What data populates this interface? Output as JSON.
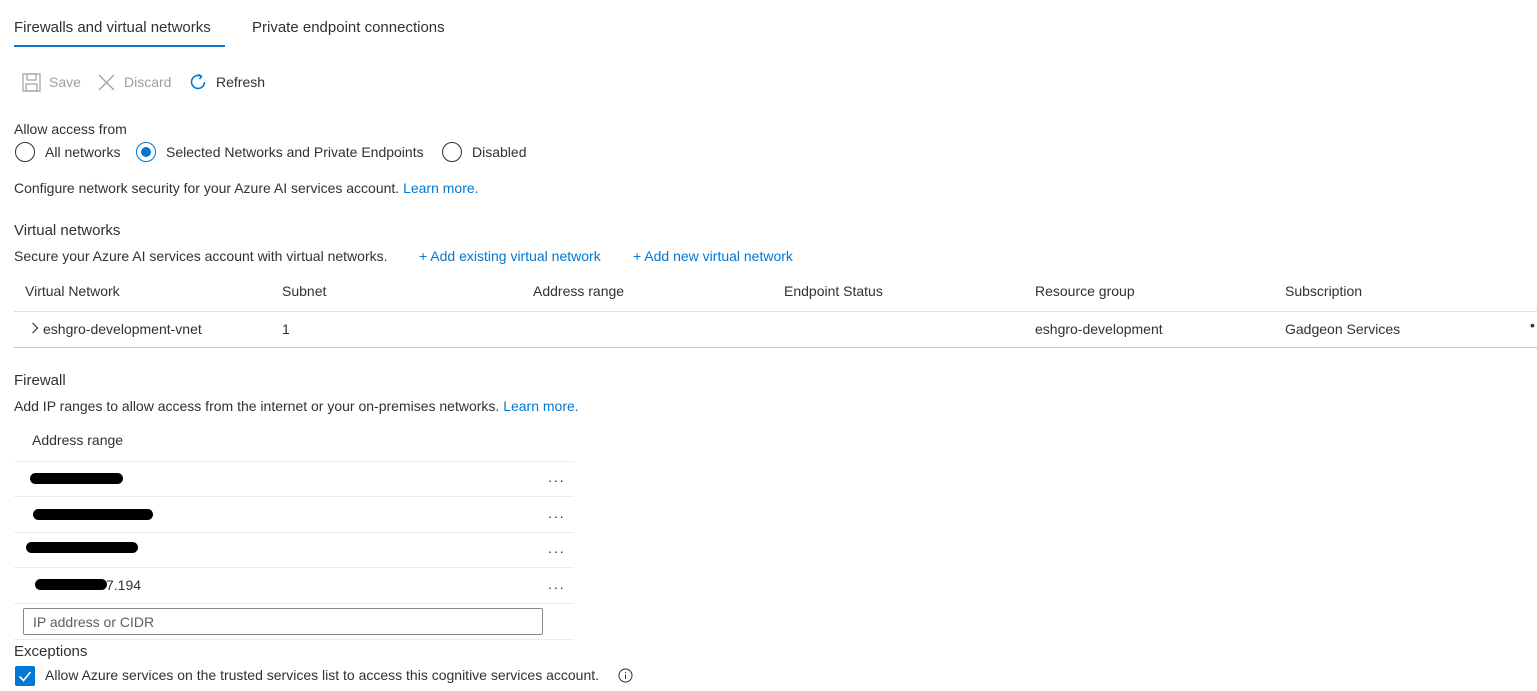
{
  "tabs": [
    {
      "label": "Firewalls and virtual networks",
      "active": true
    },
    {
      "label": "Private endpoint connections",
      "active": false
    }
  ],
  "toolbar": {
    "save_label": "Save",
    "discard_label": "Discard",
    "refresh_label": "Refresh"
  },
  "access": {
    "label": "Allow access from",
    "options": [
      {
        "label": "All networks",
        "selected": false
      },
      {
        "label": "Selected Networks and Private Endpoints",
        "selected": true
      },
      {
        "label": "Disabled",
        "selected": false
      }
    ],
    "description": "Configure network security for your Azure AI services account.",
    "learn_more": "Learn more."
  },
  "vnets": {
    "heading": "Virtual networks",
    "description": "Secure your Azure AI services account with virtual networks.",
    "add_existing": "+ Add existing virtual network",
    "add_new": "+ Add new virtual network",
    "columns": [
      "Virtual Network",
      "Subnet",
      "Address range",
      "Endpoint Status",
      "Resource group",
      "Subscription"
    ],
    "rows": [
      {
        "name": "eshgro-development-vnet",
        "subnet": "1",
        "address_range": "",
        "endpoint_status": "",
        "resource_group": "eshgro-development",
        "subscription": "Gadgeon Services"
      }
    ]
  },
  "firewall": {
    "heading": "Firewall",
    "description": "Add IP ranges to allow access from the internet or your on-premises networks.",
    "learn_more": "Learn more.",
    "column": "Address range",
    "rows": [
      {
        "visible_suffix": ""
      },
      {
        "visible_suffix": ""
      },
      {
        "visible_suffix": ""
      },
      {
        "visible_suffix": "7.194"
      }
    ],
    "ellipsis": "...",
    "input_placeholder": "IP address or CIDR"
  },
  "exceptions": {
    "heading": "Exceptions",
    "items": [
      {
        "label": "Allow Azure services on the trusted services list to access this cognitive services account.",
        "checked": true
      }
    ]
  },
  "colors": {
    "accent": "#0078d4",
    "text": "#323130",
    "disabled": "#a19f9d",
    "divider": "#e1dfdd"
  },
  "icons": [
    "save-icon",
    "close-icon",
    "refresh-icon",
    "chevron-right-icon",
    "more-icon",
    "checkmark-icon",
    "info-icon"
  ]
}
